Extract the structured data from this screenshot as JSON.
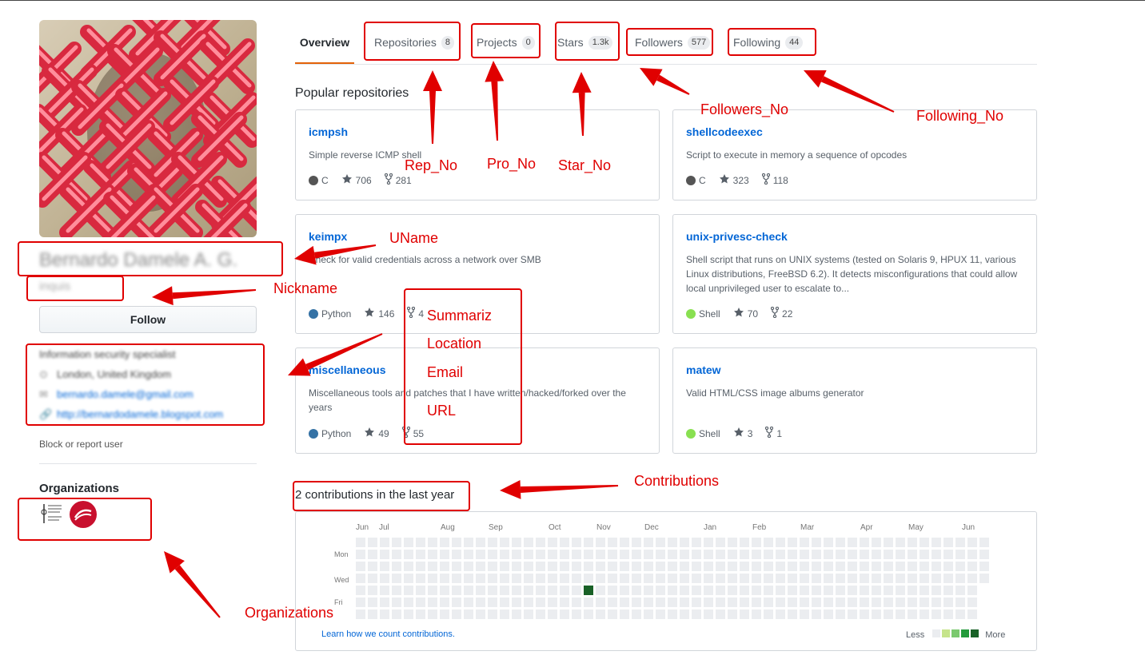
{
  "profile": {
    "username": "Bernardo Damele A. G.",
    "nickname": "inquis",
    "follow_label": "Follow",
    "bio": "Information security specialist",
    "location": "London, United Kingdom",
    "email": "bernardo.damele@gmail.com",
    "url": "http://bernardodamele.blogspot.com",
    "block_label": "Block or report user"
  },
  "organizations": {
    "title": "Organizations"
  },
  "tabs": [
    {
      "label": "Overview",
      "count": ""
    },
    {
      "label": "Repositories",
      "count": "8"
    },
    {
      "label": "Projects",
      "count": "0"
    },
    {
      "label": "Stars",
      "count": "1.3k"
    },
    {
      "label": "Followers",
      "count": "577"
    },
    {
      "label": "Following",
      "count": "44"
    }
  ],
  "popular": {
    "title": "Popular repositories",
    "repos": [
      {
        "name": "icmpsh",
        "desc": "Simple reverse ICMP shell",
        "lang": "C",
        "lang_color": "#555555",
        "stars": "706",
        "forks": "281"
      },
      {
        "name": "shellcodeexec",
        "desc": "Script to execute in memory a sequence of opcodes",
        "lang": "C",
        "lang_color": "#555555",
        "stars": "323",
        "forks": "118"
      },
      {
        "name": "keimpx",
        "desc": "Check for valid credentials across a network over SMB",
        "lang": "Python",
        "lang_color": "#3572A5",
        "stars": "146",
        "forks": "4"
      },
      {
        "name": "unix-privesc-check",
        "desc": "Shell script that runs on UNIX systems (tested on Solaris 9, HPUX 11, various Linux distributions, FreeBSD 6.2). It detects misconfigurations that could allow local unprivileged user to escalate to...",
        "lang": "Shell",
        "lang_color": "#89e051",
        "stars": "70",
        "forks": "22"
      },
      {
        "name": "miscellaneous",
        "desc": "Miscellaneous tools and patches that I have written/hacked/forked over the years",
        "lang": "Python",
        "lang_color": "#3572A5",
        "stars": "49",
        "forks": "55"
      },
      {
        "name": "matew",
        "desc": "Valid HTML/CSS image albums generator",
        "lang": "Shell",
        "lang_color": "#89e051",
        "stars": "3",
        "forks": "1"
      }
    ]
  },
  "contributions": {
    "title": "2 contributions in the last year",
    "months": [
      "Jun",
      "Jul",
      "Aug",
      "Sep",
      "Oct",
      "Nov",
      "Dec",
      "Jan",
      "Feb",
      "Mar",
      "Apr",
      "May",
      "Jun"
    ],
    "days": [
      "Mon",
      "Wed",
      "Fri"
    ],
    "learn_label": "Learn how we count contributions.",
    "less_label": "Less",
    "more_label": "More",
    "empty_color": "#ebedf0",
    "active_color": "#196127",
    "legend_colors": [
      "#ebedf0",
      "#c6e48b",
      "#7bc96f",
      "#239a3b",
      "#196127"
    ]
  },
  "annotations": {
    "rep_no": "Rep_No",
    "pro_no": "Pro_No",
    "star_no": "Star_No",
    "followers_no": "Followers_No",
    "following_no": "Following_No",
    "uname": "UName",
    "nickname": "Nickname",
    "summariz": "Summariz",
    "location": "Location",
    "email": "Email",
    "url": "URL",
    "contributions": "Contributions",
    "organizations": "Organizations",
    "color": "#e00000"
  }
}
